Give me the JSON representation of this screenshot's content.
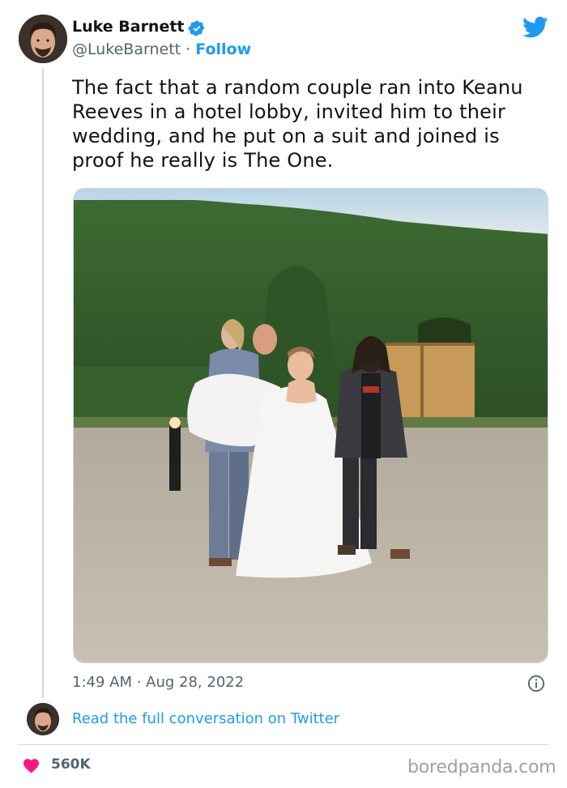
{
  "author": {
    "display_name": "Luke Barnett",
    "handle": "@LukeBarnett",
    "separator": "·",
    "follow_label": "Follow",
    "verified_icon": "verified-badge-icon",
    "avatar_icon": "avatar"
  },
  "tweet": {
    "text": "The fact that a random couple ran into Keanu Reeves in a hotel lobby, invited him to their wedding, and he put on a suit and joined is proof he really is The One.",
    "timestamp": "1:49 AM · Aug 28, 2022"
  },
  "footer": {
    "read_conversation_label": "Read the full conversation on Twitter",
    "likes_count": "560K",
    "watermark": "boredpanda.com"
  },
  "icons": {
    "twitter_logo": "twitter-bird-icon",
    "info": "info-icon",
    "heart": "heart-icon"
  },
  "colors": {
    "twitter_blue": "#1d9bf0",
    "text_primary": "#0f1419",
    "text_secondary": "#536471",
    "heart_pink": "#f91880",
    "border": "#cfd9de"
  }
}
